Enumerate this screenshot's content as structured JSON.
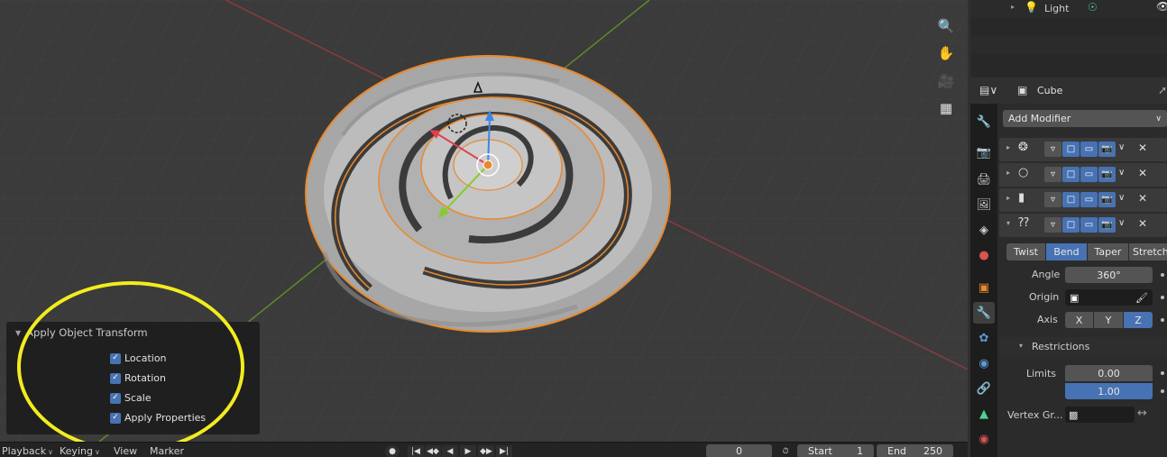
{
  "outliner": {
    "item_label": "Light"
  },
  "properties": {
    "object_name": "Cube",
    "add_modifier_label": "Add Modifier",
    "deform_tabs": [
      {
        "label": "Twist",
        "active": false
      },
      {
        "label": "Bend",
        "active": true
      },
      {
        "label": "Taper",
        "active": false
      },
      {
        "label": "Stretch",
        "active": false
      }
    ],
    "angle_label": "Angle",
    "angle_value": "360°",
    "origin_label": "Origin",
    "axis_label": "Axis",
    "axis_options": [
      {
        "label": "X",
        "active": false
      },
      {
        "label": "Y",
        "active": false
      },
      {
        "label": "Z",
        "active": true
      }
    ],
    "restrictions_label": "Restrictions",
    "limits_label": "Limits",
    "limit_low": "0.00",
    "limit_high": "1.00",
    "vertex_group_label": "Vertex Gr..."
  },
  "operator_panel": {
    "title": "Apply Object Transform",
    "options": [
      {
        "label": "Location",
        "checked": true
      },
      {
        "label": "Rotation",
        "checked": true
      },
      {
        "label": "Scale",
        "checked": true
      },
      {
        "label": "Apply Properties",
        "checked": true
      }
    ]
  },
  "timeline": {
    "menus": [
      "Playback",
      "Keying",
      "View",
      "Marker"
    ],
    "current_frame": "0",
    "start_label": "Start",
    "start_value": "1",
    "end_label": "End",
    "end_value": "250"
  },
  "colors": {
    "accent": "#4772b3",
    "selection_outline": "#e8892d",
    "highlight_circle": "#f2ec1f"
  }
}
